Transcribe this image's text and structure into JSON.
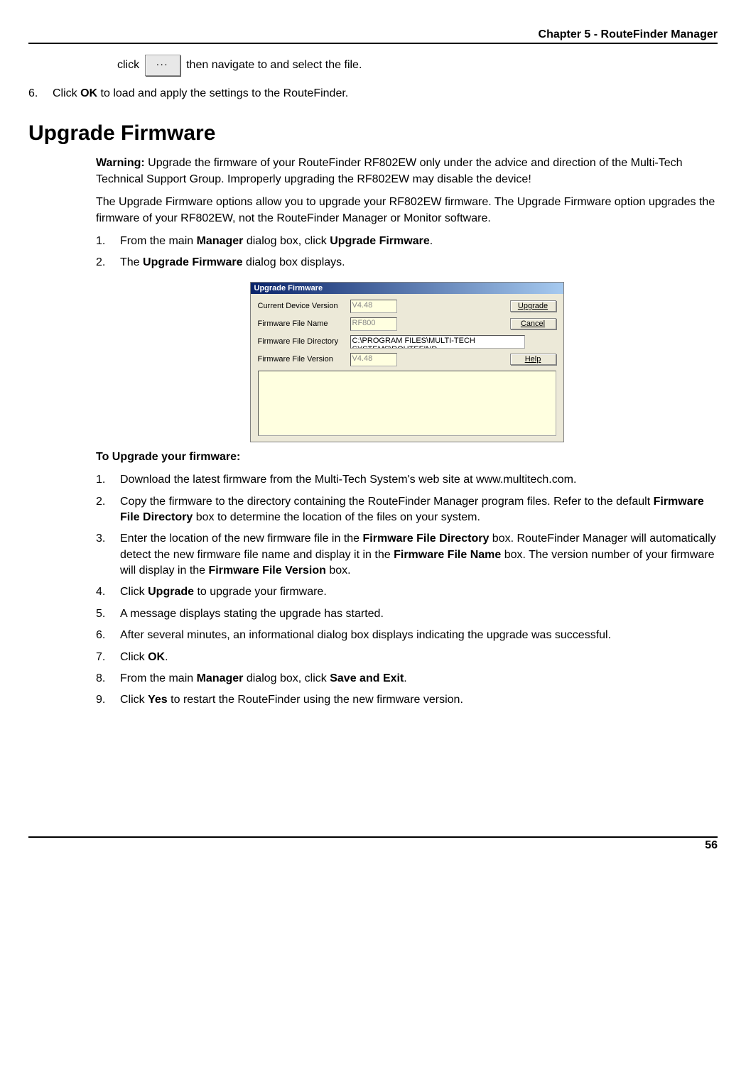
{
  "header": {
    "chapter": "Chapter 5 - RouteFinder Manager"
  },
  "top": {
    "click_pre": "click",
    "click_post": "then navigate to and select the file.",
    "item6_num": "6.",
    "item6_pre": "Click ",
    "item6_bold": "OK",
    "item6_post": " to load and apply the settings to the RouteFinder."
  },
  "h1": "Upgrade Firmware",
  "para": {
    "warning_bold": "Warning:",
    "warning_rest": " Upgrade the firmware of your RouteFinder RF802EW only under the advice and direction of the Multi-Tech Technical Support Group.  Improperly upgrading the RF802EW may disable the device!",
    "p2": "The Upgrade Firmware options allow you to upgrade your RF802EW firmware.  The Upgrade Firmware option upgrades the firmware of your RF802EW, not the RouteFinder Manager or Monitor software."
  },
  "list1": {
    "i1_num": "1.",
    "i1_a": "From the main ",
    "i1_b": "Manager",
    "i1_c": " dialog box, click ",
    "i1_d": "Upgrade Firmware",
    "i1_e": ".",
    "i2_num": "2.",
    "i2_a": "The ",
    "i2_b": "Upgrade Firmware",
    "i2_c": " dialog box displays."
  },
  "dialog": {
    "title": "Upgrade Firmware",
    "row1_label": "Current Device Version",
    "row1_val": "V4.48",
    "row2_label": "Firmware File Name",
    "row2_val": "RF800",
    "row3_label": "Firmware File Directory",
    "row3_val": "C:\\PROGRAM FILES\\MULTI-TECH SYSTEMS\\ROUTEFIND",
    "row4_label": "Firmware File Version",
    "row4_val": "V4.48",
    "btn_upgrade": "Upgrade",
    "btn_cancel": "Cancel",
    "btn_help": "Help"
  },
  "sub_h": "To Upgrade your firmware:",
  "list2": {
    "i1_num": "1.",
    "i1": " Download the latest firmware from the Multi-Tech System's web site at www.multitech.com.",
    "i2_num": "2.",
    "i2_a": "Copy the firmware to the directory containing the RouteFinder Manager program files. Refer to the default ",
    "i2_b": "Firmware File Directory",
    "i2_c": " box to determine the location of the files on your system.",
    "i3_num": "3.",
    "i3_a": "Enter the location of the new firmware file in the ",
    "i3_b": "Firmware File Directory",
    "i3_c": " box.  RouteFinder Manager will automatically detect the new firmware file name and display it in the ",
    "i3_d": "Firmware File Name",
    "i3_e": " box.  The version number of your firmware will display in the ",
    "i3_f": "Firmware File Version",
    "i3_g": " box.",
    "i4_num": "4.",
    "i4_a": "Click ",
    "i4_b": "Upgrade",
    "i4_c": " to upgrade your firmware.",
    "i5_num": "5.",
    "i5": "A message displays stating the upgrade has started.",
    "i6_num": "6.",
    "i6": "After several minutes, an informational dialog box displays indicating the upgrade was successful.",
    "i7_num": "7.",
    "i7_a": "Click ",
    "i7_b": "OK",
    "i7_c": ".",
    "i8_num": "8.",
    "i8_a": "From the main ",
    "i8_b": "Manager",
    "i8_c": " dialog box, click ",
    "i8_d": "Save and Exit",
    "i8_e": ".",
    "i9_num": "9.",
    "i9_a": "Click ",
    "i9_b": "Yes",
    "i9_c": " to restart the RouteFinder using the new firmware version."
  },
  "footer": {
    "page": "56"
  }
}
